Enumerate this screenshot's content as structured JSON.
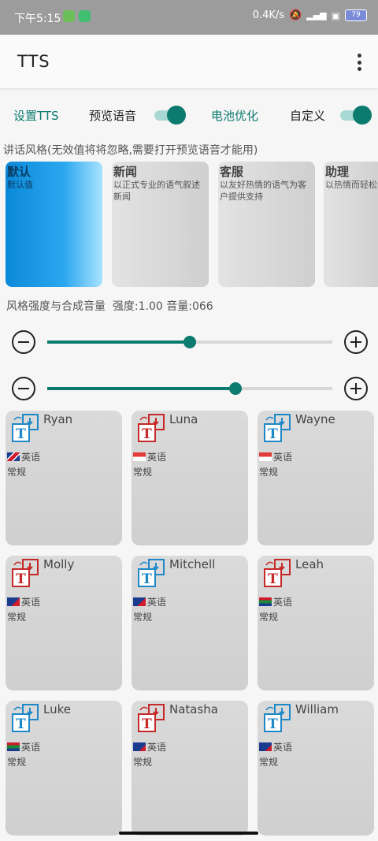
{
  "status": {
    "time": "下午5:15",
    "speed": "0.4K/s",
    "battery": "79"
  },
  "appbar": {
    "title": "TTS"
  },
  "toprow": {
    "settings_tts": "设置TTS",
    "preview_voice": "预览语音",
    "battery_opt": "电池优化",
    "custom": "自定义"
  },
  "colors": {
    "accent": "#0b7a6f",
    "accent_light": "#a7d8d3",
    "selected": "#0b89d9"
  },
  "styles_label": "讲话风格(无效值将将忽略,需要打开预览语音才能用)",
  "styles": [
    {
      "title": "默认",
      "desc": "默认值",
      "selected": true
    },
    {
      "title": "新闻",
      "desc": "以正式专业的语气叙述新闻",
      "selected": false
    },
    {
      "title": "客服",
      "desc": "以友好热情的语气为客户提供支持",
      "selected": false
    },
    {
      "title": "助理",
      "desc": "以热情而轻松的语气对数字助理讲话",
      "selected": false
    }
  ],
  "intensity_label": "风格强度与合成音量  强度:1.00 音量:066",
  "sliders": {
    "intensity_fraction": 0.5,
    "volume_fraction": 0.66
  },
  "voices": [
    {
      "name": "Ryan",
      "flag": "gb",
      "lang": "英语",
      "style": "常规",
      "icon_color": "#1e88c8"
    },
    {
      "name": "Luna",
      "flag": "sg",
      "lang": "英语",
      "style": "常规",
      "icon_color": "#c62828"
    },
    {
      "name": "Wayne",
      "flag": "sg",
      "lang": "英语",
      "style": "常规",
      "icon_color": "#1e88c8"
    },
    {
      "name": "Molly",
      "flag": "nz",
      "lang": "英语",
      "style": "常规",
      "icon_color": "#c62828"
    },
    {
      "name": "Mitchell",
      "flag": "nz",
      "lang": "英语",
      "style": "常规",
      "icon_color": "#1e88c8"
    },
    {
      "name": "Leah",
      "flag": "za",
      "lang": "英语",
      "style": "常规",
      "icon_color": "#c62828"
    },
    {
      "name": "Luke",
      "flag": "za",
      "lang": "英语",
      "style": "常规",
      "icon_color": "#1e88c8"
    },
    {
      "name": "Natasha",
      "flag": "au",
      "lang": "英语",
      "style": "常规",
      "icon_color": "#c62828"
    },
    {
      "name": "William",
      "flag": "au",
      "lang": "英语",
      "style": "常规",
      "icon_color": "#1e88c8"
    }
  ]
}
